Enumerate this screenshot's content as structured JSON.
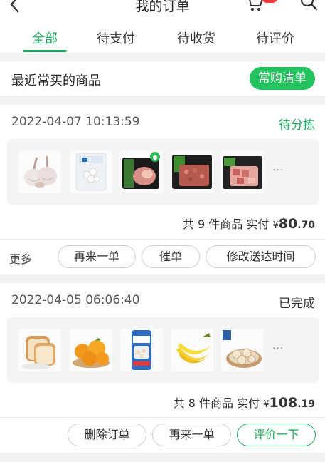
{
  "header": {
    "title": "我的订单"
  },
  "tabs": [
    {
      "label": "全部"
    },
    {
      "label": "待支付"
    },
    {
      "label": "待收货"
    },
    {
      "label": "待评价"
    }
  ],
  "frequent": {
    "title": "最近常买的商品",
    "button": "常购清单"
  },
  "orders": [
    {
      "date": "2022-04-07 10:13:59",
      "status": "待分拣",
      "products": [
        "garlic",
        "tangyuan",
        "pork-trotter",
        "minced-pork",
        "pork-cubes"
      ],
      "more": "···",
      "summary_prefix": "共 9 件商品 实付",
      "currency": "¥",
      "amount_int": "80",
      "amount_dec": ".70",
      "more_label": "更多",
      "actions": [
        "再来一单",
        "催单",
        "修改送达时间"
      ]
    },
    {
      "date": "2022-04-05 06:06:40",
      "status": "已完成",
      "products": [
        "toast-bread",
        "oranges",
        "frozen-dumplings",
        "bananas",
        "shumai"
      ],
      "more": "···",
      "summary_prefix": "共 8 件商品 实付",
      "currency": "¥",
      "amount_int": "108",
      "amount_dec": ".19",
      "actions": [
        "删除订单",
        "再来一单",
        "评价一下"
      ]
    }
  ],
  "colors": {
    "accent": "#1aad5a",
    "badge": "#f23b3b",
    "frequent_button": "#22c25e"
  }
}
